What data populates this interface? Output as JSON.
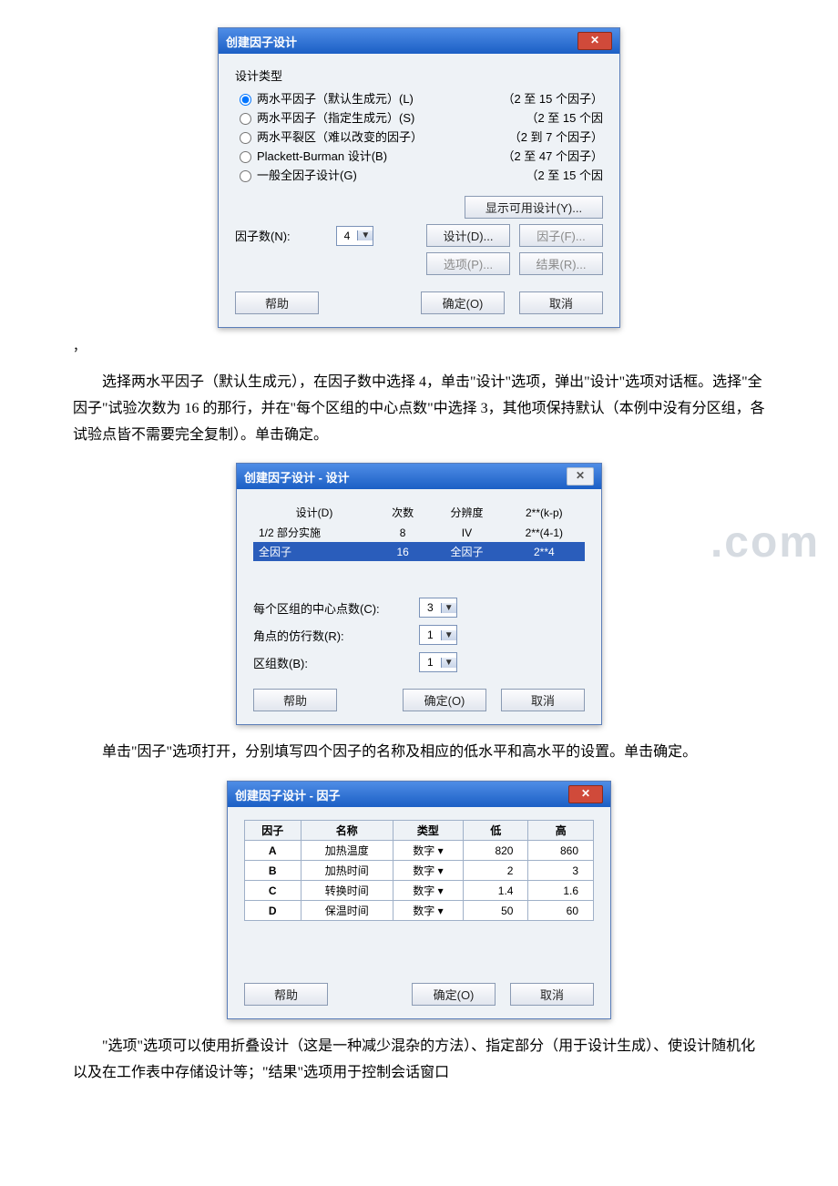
{
  "dialog1": {
    "title": "创建因子设计",
    "group": "设计类型",
    "radios": [
      {
        "label": "两水平因子（默认生成元）(L)",
        "range": "（2 至 15 个因子）",
        "checked": true
      },
      {
        "label": "两水平因子（指定生成元）(S)",
        "range": "（2 至 15 个因",
        "checked": false
      },
      {
        "label": "两水平裂区（难以改变的因子）",
        "range": "（2 到 7 个因子）",
        "checked": false
      },
      {
        "label": "Plackett-Burman 设计(B)",
        "range": "（2 至 47 个因子）",
        "checked": false
      },
      {
        "label": "一般全因子设计(G)",
        "range": "（2 至 15 个因",
        "checked": false
      }
    ],
    "factorNumLabel": "因子数(N):",
    "factorNumValue": "4",
    "showAvail": "显示可用设计(Y)...",
    "designBtn": "设计(D)...",
    "factorBtn": "因子(F)...",
    "optionBtn": "选项(P)...",
    "resultBtn": "结果(R)...",
    "help": "帮助",
    "ok": "确定(O)",
    "cancel": "取消"
  },
  "para1": "选择两水平因子（默认生成元），在因子数中选择 4，单击\"设计\"选项，弹出\"设计\"选项对话框。选择\"全因子\"试验次数为 16 的那行，并在\"每个区组的中心点数\"中选择 3，其他项保持默认（本例中没有分区组，各试验点皆不需要完全复制）。单击确定。",
  "dialog2": {
    "title": "创建因子设计 - 设计",
    "headers": [
      "设计(D)",
      "次数",
      "分辨度",
      "2**(k-p)"
    ],
    "rows": [
      {
        "c0": "1/2 部分实施",
        "c1": "8",
        "c2": "IV",
        "c3": "2**(4-1)",
        "sel": false
      },
      {
        "c0": "全因子",
        "c1": "16",
        "c2": "全因子",
        "c3": "2**4",
        "sel": true
      }
    ],
    "centerLabel": "每个区组的中心点数(C):",
    "centerVal": "3",
    "repsLabel": "角点的仿行数(R):",
    "repsVal": "1",
    "blocksLabel": "区组数(B):",
    "blocksVal": "1",
    "help": "帮助",
    "ok": "确定(O)",
    "cancel": "取消"
  },
  "para2": "单击\"因子\"选项打开，分别填写四个因子的名称及相应的低水平和高水平的设置。单击确定。",
  "dialog3": {
    "title": "创建因子设计 - 因子",
    "headers": [
      "因子",
      "名称",
      "类型",
      "低",
      "高"
    ],
    "rows": [
      {
        "f": "A",
        "name": "加热温度",
        "type": "数字",
        "low": "820",
        "high": "860"
      },
      {
        "f": "B",
        "name": "加热时间",
        "type": "数字",
        "low": "2",
        "high": "3"
      },
      {
        "f": "C",
        "name": "转换时间",
        "type": "数字",
        "low": "1.4",
        "high": "1.6"
      },
      {
        "f": "D",
        "name": "保温时间",
        "type": "数字",
        "low": "50",
        "high": "60"
      }
    ],
    "help": "帮助",
    "ok": "确定(O)",
    "cancel": "取消"
  },
  "para3": "\"选项\"选项可以使用折叠设计（这是一种减少混杂的方法）、指定部分（用于设计生成）、使设计随机化以及在工作表中存储设计等；\"结果\"选项用于控制会话窗口"
}
